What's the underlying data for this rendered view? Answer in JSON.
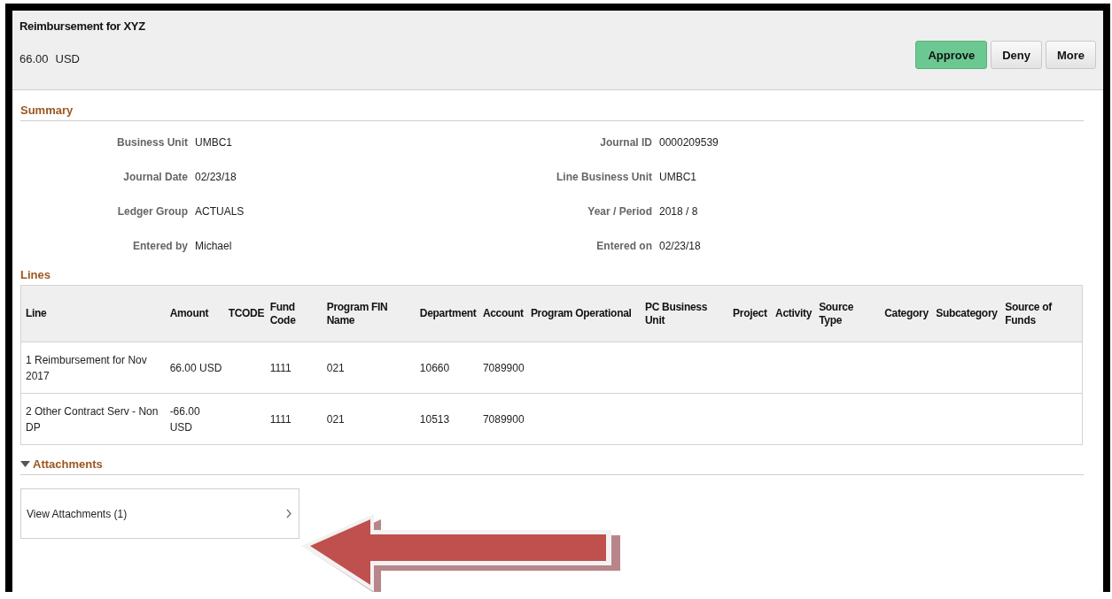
{
  "header": {
    "title": "Reimbursement for XYZ",
    "amount": "66.00",
    "currency": "USD",
    "buttons": [
      {
        "label": "Approve",
        "kind": "primary"
      },
      {
        "label": "Deny",
        "kind": "default"
      },
      {
        "label": "More",
        "kind": "default"
      }
    ]
  },
  "summary": {
    "title": "Summary",
    "left": [
      {
        "label": "Business Unit",
        "value": "UMBC1"
      },
      {
        "label": "Journal Date",
        "value": "02/23/18"
      },
      {
        "label": "Ledger Group",
        "value": "ACTUALS"
      },
      {
        "label": "Entered by",
        "value": "Michael"
      }
    ],
    "right": [
      {
        "label": "Journal ID",
        "value": "0000209539"
      },
      {
        "label": "Line Business Unit",
        "value": "UMBC1"
      },
      {
        "label": "Year / Period",
        "value": "2018 / 8"
      },
      {
        "label": "Entered on",
        "value": "02/23/18"
      }
    ]
  },
  "lines": {
    "title": "Lines",
    "columns": [
      "Line",
      "Amount",
      "TCODE",
      "Fund Code",
      "Program FIN Name",
      "Department",
      "Account",
      "Program Operational",
      "PC Business Unit",
      "Project",
      "Activity",
      "Source Type",
      "Category",
      "Subcategory",
      "Source of Funds"
    ],
    "rows": [
      {
        "cells": [
          "1 Reimbursement for Nov 2017",
          "66.00 USD",
          "",
          "1111",
          "021",
          "10660",
          "7089900"
        ]
      },
      {
        "cells": [
          "2 Other Contract Serv - Non DP",
          "-66.00 USD",
          "",
          "1111",
          "021",
          "10513",
          "7089900"
        ]
      }
    ]
  },
  "attachments": {
    "title": "Attachments",
    "expanded": true,
    "link": "View Attachments (1)"
  }
}
